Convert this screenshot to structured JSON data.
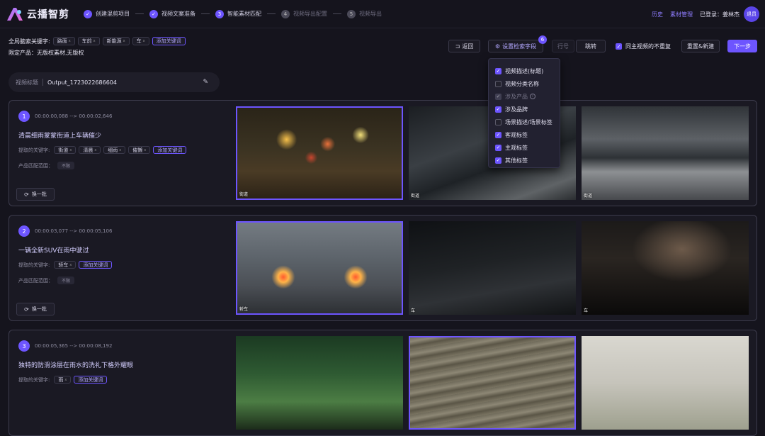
{
  "app": {
    "name": "云播智剪"
  },
  "steps": [
    {
      "n": "✓",
      "label": "创建混剪项目",
      "state": "done"
    },
    {
      "n": "✓",
      "label": "视频文案准备",
      "state": "done"
    },
    {
      "n": "3",
      "label": "智能素材匹配",
      "state": "active"
    },
    {
      "n": "4",
      "label": "视频导出配置",
      "state": "todo"
    },
    {
      "n": "5",
      "label": "视频导出",
      "state": "todo"
    }
  ],
  "top": {
    "history": "历史",
    "assets": "素材管理",
    "user": "已登录：姜林杰",
    "avatar": "退员"
  },
  "global": {
    "kw_label": "全局脑索关键字:",
    "keywords": [
      "路面",
      "车前",
      "新能源",
      "车"
    ],
    "add_label": "添加关键词",
    "limit": "限定产品：无版权素材,无版权"
  },
  "toolbar": {
    "back": "返回",
    "fields": "设置检索字段",
    "fields_count": "6",
    "row_label": "行号",
    "jump": "跳转",
    "no_dup": "同主视频的不重复",
    "reset": "重置&新建",
    "next": "下一步"
  },
  "dropdown": [
    {
      "label": "视频描述(标题)",
      "state": "on"
    },
    {
      "label": "视频分类名称",
      "state": "off"
    },
    {
      "label": "涉及产品",
      "state": "dis"
    },
    {
      "label": "涉及品牌",
      "state": "on"
    },
    {
      "label": "场景描述/场景标签",
      "state": "off"
    },
    {
      "label": "客观标签",
      "state": "on"
    },
    {
      "label": "主观标签",
      "state": "on"
    },
    {
      "label": "其他标签",
      "state": "on"
    }
  ],
  "title_box": {
    "label": "视频标题",
    "value": "Output_1723022686604"
  },
  "labels": {
    "kw": "提取的关键字:",
    "range": "产品匹配范围：",
    "range_val": "不限",
    "swap": "换一批",
    "add": "添加关键词"
  },
  "segments": [
    {
      "num": "1",
      "time": "00:00:00,088 --> 00:00:02,646",
      "caption": "清晨细雨蒙蒙街道上车辆催少",
      "keywords": [
        "街道",
        "清晨",
        "细雨",
        "催懒"
      ],
      "thumbs": [
        {
          "label": "街道"
        },
        {
          "label": "街道"
        },
        {
          "label": "街道"
        }
      ]
    },
    {
      "num": "2",
      "time": "00:00:03,077 --> 00:00:05,106",
      "caption": "一辆全新SUV在雨中驶过",
      "keywords": [
        "轿车"
      ],
      "thumbs": [
        {
          "label": "轿车"
        },
        {
          "label": "车"
        },
        {
          "label": "车"
        }
      ]
    },
    {
      "num": "3",
      "time": "00:00:05,365 --> 00:00:08,192",
      "caption": "独特的防滑涂层在雨水的洗礼下格外耀眼",
      "keywords": [
        "雨"
      ],
      "thumbs": [
        {
          "label": ""
        },
        {
          "label": ""
        },
        {
          "label": ""
        }
      ]
    }
  ]
}
